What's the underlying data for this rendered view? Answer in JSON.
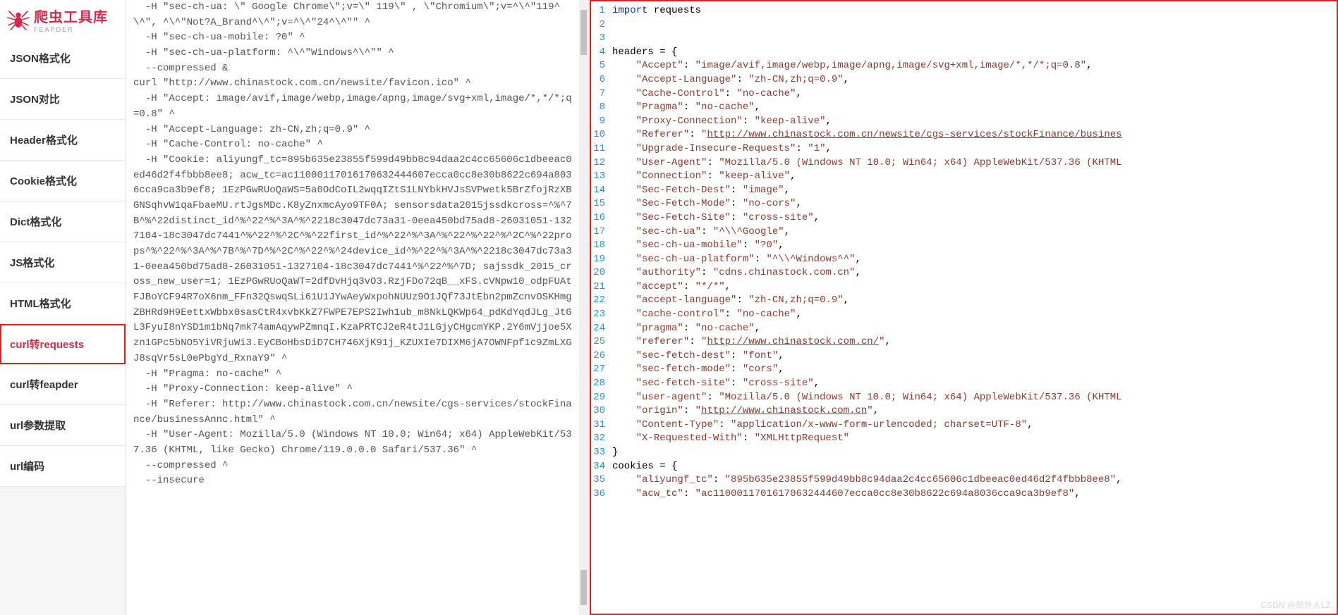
{
  "logo": {
    "title": "爬虫工具库",
    "subtitle": "FEAPDER"
  },
  "nav": [
    "JSON格式化",
    "JSON对比",
    "Header格式化",
    "Cookie格式化",
    "Dict格式化",
    "JS格式化",
    "HTML格式化",
    "curl转requests",
    "curl转feapder",
    "url参数提取",
    "url编码"
  ],
  "nav_active_index": 7,
  "curl_input": "  -H \"sec-ch-ua: \\\" Google Chrome\\\";v=\\\" 119\\\" , \\\"Chromium\\\";v=^\\^\"119^\\^\", ^\\^\"Not?A_Brand^\\^\";v=^\\^\"24^\\^\"\" ^\n  -H \"sec-ch-ua-mobile: ?0\" ^\n  -H \"sec-ch-ua-platform: ^\\^\"Windows^\\^\"\" ^\n  --compressed &\ncurl \"http://www.chinastock.com.cn/newsite/favicon.ico\" ^\n  -H \"Accept: image/avif,image/webp,image/apng,image/svg+xml,image/*,*/*;q=0.8\" ^\n  -H \"Accept-Language: zh-CN,zh;q=0.9\" ^\n  -H \"Cache-Control: no-cache\" ^\n  -H \"Cookie: aliyungf_tc=895b635e23855f599d49bb8c94daa2c4cc65606c1dbeeac0ed46d2f4fbbb8ee8; acw_tc=ac11000117016170632444607ecca0cc8e30b8622c694a8036cca9ca3b9ef8; 1EzPGwRUoQaWS=5a0OdCoIL2wqqIZtS1LNYbkHVJsSVPwetk5BrZfojRzXBGNSqhvW1qaFbaeMU.rtJgsMDc.K8yZnxmcAyo9TF0A; sensorsdata2015jssdkcross=^%^7B^%^22distinct_id^%^22^%^3A^%^2218c3047dc73a31-0eea450bd75ad8-26031051-1327104-18c3047dc7441^%^22^%^2C^%^22first_id^%^22^%^3A^%^22^%^22^%^2C^%^22props^%^22^%^3A^%^7B^%^7D^%^2C^%^22^%^24device_id^%^22^%^3A^%^2218c3047dc73a31-0eea450bd75ad8-26031051-1327104-18c3047dc7441^%^22^%^7D; sajssdk_2015_cross_new_user=1; 1EzPGwRUoQaWT=2dfDvHjq3vO3.RzjFDo72qB__xFS.cVNpw10_odpFUAtFJBoYCF94R7oX6nm_FFn32QswqSLi61U1JYwAeyWxpohNUUz9O1JQf73JtEbn2pmZcnvOSKHmgZBHRd9H9EettxWbbx0sasCtR4xvbKkZ7FWPE7EPS2Iwh1ub_m8NkLQKWp64_pdKdYqdJLg_JtGL3FyuI8nYSD1m1bNq7mk74amAqywPZmnqI.KzaPRTCJ2eR4tJ1LGjyCHgcmYKP.2Y6mVjjoe5Xzn1GPc5bNO5YiVRjuWi3.EyCBoHbsDiD7CH746XjK91j_KZUXIe7DIXM6jA7OWNFpf1c9ZmLXGJ8sqVr5sL0ePbgYd_RxnaY9\" ^\n  -H \"Pragma: no-cache\" ^\n  -H \"Proxy-Connection: keep-alive\" ^\n  -H \"Referer: http://www.chinastock.com.cn/newsite/cgs-services/stockFinance/businessAnnc.html\" ^\n  -H \"User-Agent: Mozilla/5.0 (Windows NT 10.0; Win64; x64) AppleWebKit/537.36 (KHTML, like Gecko) Chrome/119.0.0.0 Safari/537.36\" ^\n  --compressed ^\n  --insecure",
  "code_lines": [
    {
      "n": 1,
      "seg": [
        [
          "kw",
          "import"
        ],
        [
          "nm",
          " requests"
        ]
      ]
    },
    {
      "n": 2,
      "seg": []
    },
    {
      "n": 3,
      "seg": []
    },
    {
      "n": 4,
      "seg": [
        [
          "nm",
          "headers "
        ],
        [
          "pn",
          "= {"
        ]
      ]
    },
    {
      "n": 5,
      "seg": [
        [
          "nm",
          "    "
        ],
        [
          "str",
          "\"Accept\""
        ],
        [
          "pn",
          ": "
        ],
        [
          "str",
          "\"image/avif,image/webp,image/apng,image/svg+xml,image/*,*/*;q=0.8\""
        ],
        [
          "pn",
          ","
        ]
      ]
    },
    {
      "n": 6,
      "seg": [
        [
          "nm",
          "    "
        ],
        [
          "str",
          "\"Accept-Language\""
        ],
        [
          "pn",
          ": "
        ],
        [
          "str",
          "\"zh-CN,zh;q=0.9\""
        ],
        [
          "pn",
          ","
        ]
      ]
    },
    {
      "n": 7,
      "seg": [
        [
          "nm",
          "    "
        ],
        [
          "str",
          "\"Cache-Control\""
        ],
        [
          "pn",
          ": "
        ],
        [
          "str",
          "\"no-cache\""
        ],
        [
          "pn",
          ","
        ]
      ]
    },
    {
      "n": 8,
      "seg": [
        [
          "nm",
          "    "
        ],
        [
          "str",
          "\"Pragma\""
        ],
        [
          "pn",
          ": "
        ],
        [
          "str",
          "\"no-cache\""
        ],
        [
          "pn",
          ","
        ]
      ]
    },
    {
      "n": 9,
      "seg": [
        [
          "nm",
          "    "
        ],
        [
          "str",
          "\"Proxy-Connection\""
        ],
        [
          "pn",
          ": "
        ],
        [
          "str",
          "\"keep-alive\""
        ],
        [
          "pn",
          ","
        ]
      ]
    },
    {
      "n": 10,
      "seg": [
        [
          "nm",
          "    "
        ],
        [
          "str",
          "\"Referer\""
        ],
        [
          "pn",
          ": "
        ],
        [
          "str",
          "\""
        ],
        [
          "link",
          "http://www.chinastock.com.cn/newsite/cgs-services/stockFinance/busines"
        ]
      ]
    },
    {
      "n": 11,
      "seg": [
        [
          "nm",
          "    "
        ],
        [
          "str",
          "\"Upgrade-Insecure-Requests\""
        ],
        [
          "pn",
          ": "
        ],
        [
          "str",
          "\"1\""
        ],
        [
          "pn",
          ","
        ]
      ]
    },
    {
      "n": 12,
      "seg": [
        [
          "nm",
          "    "
        ],
        [
          "str",
          "\"User-Agent\""
        ],
        [
          "pn",
          ": "
        ],
        [
          "str",
          "\"Mozilla/5.0 (Windows NT 10.0; Win64; x64) AppleWebKit/537.36 (KHTML"
        ]
      ]
    },
    {
      "n": 13,
      "seg": [
        [
          "nm",
          "    "
        ],
        [
          "str",
          "\"Connection\""
        ],
        [
          "pn",
          ": "
        ],
        [
          "str",
          "\"keep-alive\""
        ],
        [
          "pn",
          ","
        ]
      ]
    },
    {
      "n": 14,
      "seg": [
        [
          "nm",
          "    "
        ],
        [
          "str",
          "\"Sec-Fetch-Dest\""
        ],
        [
          "pn",
          ": "
        ],
        [
          "str",
          "\"image\""
        ],
        [
          "pn",
          ","
        ]
      ]
    },
    {
      "n": 15,
      "seg": [
        [
          "nm",
          "    "
        ],
        [
          "str",
          "\"Sec-Fetch-Mode\""
        ],
        [
          "pn",
          ": "
        ],
        [
          "str",
          "\"no-cors\""
        ],
        [
          "pn",
          ","
        ]
      ]
    },
    {
      "n": 16,
      "seg": [
        [
          "nm",
          "    "
        ],
        [
          "str",
          "\"Sec-Fetch-Site\""
        ],
        [
          "pn",
          ": "
        ],
        [
          "str",
          "\"cross-site\""
        ],
        [
          "pn",
          ","
        ]
      ]
    },
    {
      "n": 17,
      "seg": [
        [
          "nm",
          "    "
        ],
        [
          "str",
          "\"sec-ch-ua\""
        ],
        [
          "pn",
          ": "
        ],
        [
          "str",
          "\"^\\\\^Google\""
        ],
        [
          "pn",
          ","
        ]
      ]
    },
    {
      "n": 18,
      "seg": [
        [
          "nm",
          "    "
        ],
        [
          "str",
          "\"sec-ch-ua-mobile\""
        ],
        [
          "pn",
          ": "
        ],
        [
          "str",
          "\"?0\""
        ],
        [
          "pn",
          ","
        ]
      ]
    },
    {
      "n": 19,
      "seg": [
        [
          "nm",
          "    "
        ],
        [
          "str",
          "\"sec-ch-ua-platform\""
        ],
        [
          "pn",
          ": "
        ],
        [
          "str",
          "\"^\\\\^Windows^^\""
        ],
        [
          "pn",
          ","
        ]
      ]
    },
    {
      "n": 20,
      "seg": [
        [
          "nm",
          "    "
        ],
        [
          "str",
          "\"authority\""
        ],
        [
          "pn",
          ": "
        ],
        [
          "str",
          "\"cdns.chinastock.com.cn\""
        ],
        [
          "pn",
          ","
        ]
      ]
    },
    {
      "n": 21,
      "seg": [
        [
          "nm",
          "    "
        ],
        [
          "str",
          "\"accept\""
        ],
        [
          "pn",
          ": "
        ],
        [
          "str",
          "\"*/*\""
        ],
        [
          "pn",
          ","
        ]
      ]
    },
    {
      "n": 22,
      "seg": [
        [
          "nm",
          "    "
        ],
        [
          "str",
          "\"accept-language\""
        ],
        [
          "pn",
          ": "
        ],
        [
          "str",
          "\"zh-CN,zh;q=0.9\""
        ],
        [
          "pn",
          ","
        ]
      ]
    },
    {
      "n": 23,
      "seg": [
        [
          "nm",
          "    "
        ],
        [
          "str",
          "\"cache-control\""
        ],
        [
          "pn",
          ": "
        ],
        [
          "str",
          "\"no-cache\""
        ],
        [
          "pn",
          ","
        ]
      ]
    },
    {
      "n": 24,
      "seg": [
        [
          "nm",
          "    "
        ],
        [
          "str",
          "\"pragma\""
        ],
        [
          "pn",
          ": "
        ],
        [
          "str",
          "\"no-cache\""
        ],
        [
          "pn",
          ","
        ]
      ]
    },
    {
      "n": 25,
      "seg": [
        [
          "nm",
          "    "
        ],
        [
          "str",
          "\"referer\""
        ],
        [
          "pn",
          ": "
        ],
        [
          "str",
          "\""
        ],
        [
          "link",
          "http://www.chinastock.com.cn/"
        ],
        [
          "str",
          "\""
        ],
        [
          "pn",
          ","
        ]
      ]
    },
    {
      "n": 26,
      "seg": [
        [
          "nm",
          "    "
        ],
        [
          "str",
          "\"sec-fetch-dest\""
        ],
        [
          "pn",
          ": "
        ],
        [
          "str",
          "\"font\""
        ],
        [
          "pn",
          ","
        ]
      ]
    },
    {
      "n": 27,
      "seg": [
        [
          "nm",
          "    "
        ],
        [
          "str",
          "\"sec-fetch-mode\""
        ],
        [
          "pn",
          ": "
        ],
        [
          "str",
          "\"cors\""
        ],
        [
          "pn",
          ","
        ]
      ]
    },
    {
      "n": 28,
      "seg": [
        [
          "nm",
          "    "
        ],
        [
          "str",
          "\"sec-fetch-site\""
        ],
        [
          "pn",
          ": "
        ],
        [
          "str",
          "\"cross-site\""
        ],
        [
          "pn",
          ","
        ]
      ]
    },
    {
      "n": 29,
      "seg": [
        [
          "nm",
          "    "
        ],
        [
          "str",
          "\"user-agent\""
        ],
        [
          "pn",
          ": "
        ],
        [
          "str",
          "\"Mozilla/5.0 (Windows NT 10.0; Win64; x64) AppleWebKit/537.36 (KHTML"
        ]
      ]
    },
    {
      "n": 30,
      "seg": [
        [
          "nm",
          "    "
        ],
        [
          "str",
          "\"origin\""
        ],
        [
          "pn",
          ": "
        ],
        [
          "str",
          "\""
        ],
        [
          "link",
          "http://www.chinastock.com.cn"
        ],
        [
          "str",
          "\""
        ],
        [
          "pn",
          ","
        ]
      ]
    },
    {
      "n": 31,
      "seg": [
        [
          "nm",
          "    "
        ],
        [
          "str",
          "\"Content-Type\""
        ],
        [
          "pn",
          ": "
        ],
        [
          "str",
          "\"application/x-www-form-urlencoded; charset=UTF-8\""
        ],
        [
          "pn",
          ","
        ]
      ]
    },
    {
      "n": 32,
      "seg": [
        [
          "nm",
          "    "
        ],
        [
          "str",
          "\"X-Requested-With\""
        ],
        [
          "pn",
          ": "
        ],
        [
          "str",
          "\"XMLHttpRequest\""
        ]
      ]
    },
    {
      "n": 33,
      "seg": [
        [
          "pn",
          "}"
        ]
      ]
    },
    {
      "n": 34,
      "seg": [
        [
          "nm",
          "cookies "
        ],
        [
          "pn",
          "= {"
        ]
      ]
    },
    {
      "n": 35,
      "seg": [
        [
          "nm",
          "    "
        ],
        [
          "str",
          "\"aliyungf_tc\""
        ],
        [
          "pn",
          ": "
        ],
        [
          "str",
          "\"895b635e23855f599d49bb8c94daa2c4cc65606c1dbeeac0ed46d2f4fbbb8ee8\""
        ],
        [
          "pn",
          ","
        ]
      ]
    },
    {
      "n": 36,
      "seg": [
        [
          "nm",
          "    "
        ],
        [
          "str",
          "\"acw_tc\""
        ],
        [
          "pn",
          ": "
        ],
        [
          "str",
          "\"ac11000117016170632444607ecca0cc8e30b8622c694a8036cca9ca3b9ef8\""
        ],
        [
          "pn",
          ","
        ]
      ]
    }
  ],
  "watermark": "CSDN @局外人LZ"
}
